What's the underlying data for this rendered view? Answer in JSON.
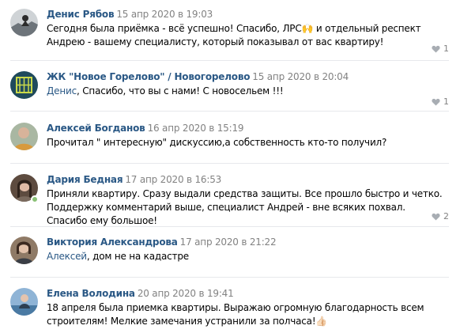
{
  "comments": [
    {
      "author": "Денис Рябов",
      "date": "15 апр 2020 в 19:03",
      "text": "Сегодня была приёмка - всё успешно! Спасибо, ЛРС🙌 и отдельный респект Андрею - вашему специалисту, который показывал от вас квартиру!",
      "likes": "1",
      "online": false
    },
    {
      "author": "ЖК \"Новое Горелово\" / Новогорелово",
      "date": "15 апр 2020 в 20:04",
      "reply_to": "Денис",
      "text": ", Спасибо, что вы с нами! С новосельем !!!",
      "likes": "1",
      "online": false
    },
    {
      "author": "Алексей Богданов",
      "date": "16 апр 2020 в 15:19",
      "text": "Прочитал \" интересную\" дискуссию,а собственность кто-то получил?",
      "likes": "",
      "online": false
    },
    {
      "author": "Дария Бедная",
      "date": "17 апр 2020 в 16:53",
      "text": "Приняли квартиру. Сразу выдали средства защиты. Все прошло быстро и четко. Поддержку комментарий выше, специалист Андрей - вне всяких похвал. Спасибо ему большое!",
      "likes": "2",
      "online": true
    },
    {
      "author": "Виктория Александрова",
      "date": "17 апр 2020 в 21:22",
      "reply_to": "Алексей",
      "text": ", дом не на кадастре",
      "likes": "",
      "online": false
    },
    {
      "author": "Елена Володина",
      "date": "20 апр 2020 в 19:41",
      "text": "18 апреля была приемка квартиры. Выражаю огромную благодарность всем строителям! Мелкие замечания устранили за полчаса!👍🏻",
      "likes": "",
      "online": false
    }
  ],
  "colors": {
    "link": "#2a5885",
    "muted": "#828282",
    "separator": "#e7e8ec",
    "online": "#8ac176"
  }
}
